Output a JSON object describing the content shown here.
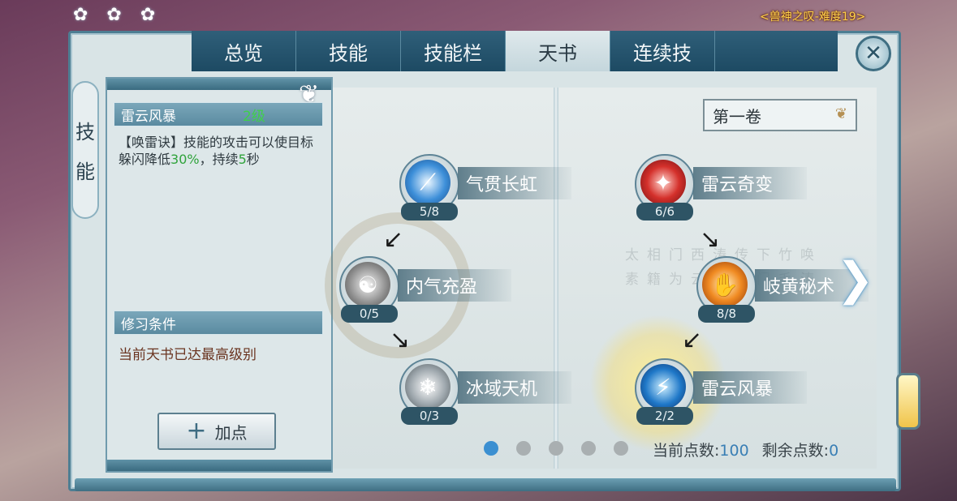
{
  "hud": {
    "top_label": "<兽神之叹-难度19>",
    "top_small": ""
  },
  "tabs": [
    {
      "label": "总览"
    },
    {
      "label": "技能"
    },
    {
      "label": "技能栏"
    },
    {
      "label": "天书"
    },
    {
      "label": "连续技"
    }
  ],
  "active_tab": "天书",
  "side_tag": [
    "技",
    "能"
  ],
  "close": "✕",
  "skill": {
    "name": "雷云风暴",
    "level": "2级",
    "desc_prefix": "【唤雷诀】技能的攻击可以使目标躲闪降低",
    "desc_value1": "30%",
    "desc_mid": "，持续",
    "desc_value2": "5",
    "desc_suffix": "秒"
  },
  "condition": {
    "title": "修习条件",
    "text": "当前天书已达最高级别"
  },
  "add_button": {
    "icon": "+",
    "label": "加点"
  },
  "volume": {
    "selected": "第一卷"
  },
  "nodes": [
    {
      "name": "气贯长虹",
      "count": "5/8",
      "icon": "sword-qi-icon"
    },
    {
      "name": "内气充盈",
      "count": "0/5",
      "icon": "meditation-icon"
    },
    {
      "name": "冰域天机",
      "count": "0/3",
      "icon": "ice-wing-icon"
    },
    {
      "name": "雷云奇变",
      "count": "6/6",
      "icon": "red-claw-icon"
    },
    {
      "name": "岐黄秘术",
      "count": "8/8",
      "icon": "healing-hand-icon"
    },
    {
      "name": "雷云风暴",
      "count": "2/2",
      "icon": "lightning-storm-icon"
    }
  ],
  "page_dots": {
    "total": 5,
    "current": 1
  },
  "points": {
    "current_label": "当前点数:",
    "current_value": "100",
    "remaining_label": "剩余点数:",
    "remaining_value": "0"
  },
  "poem_text": "太相门西涛传下竹唤素籍为云英太门毛涛"
}
